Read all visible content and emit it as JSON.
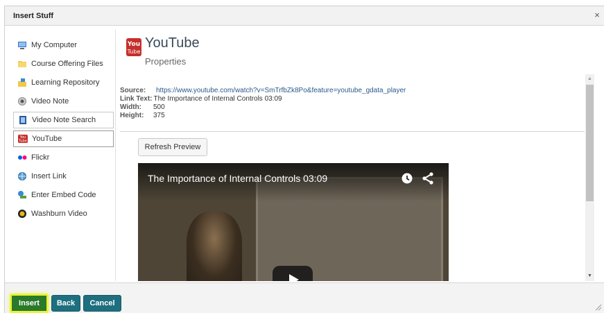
{
  "dialog": {
    "title": "Insert Stuff",
    "close_symbol": "×"
  },
  "sidebar": {
    "items": [
      {
        "label": "My Computer",
        "icon": "computer-icon"
      },
      {
        "label": "Course Offering Files",
        "icon": "folder-icon"
      },
      {
        "label": "Learning Repository",
        "icon": "repository-icon"
      },
      {
        "label": "Video Note",
        "icon": "webcam-icon"
      },
      {
        "label": "Video Note Search",
        "icon": "film-icon"
      },
      {
        "label": "YouTube",
        "icon": "youtube-icon",
        "selected": true
      },
      {
        "label": "Flickr",
        "icon": "flickr-icon"
      },
      {
        "label": "Insert Link",
        "icon": "globe-link-icon"
      },
      {
        "label": "Enter Embed Code",
        "icon": "embed-icon"
      },
      {
        "label": "Washburn Video",
        "icon": "washburn-video-icon"
      }
    ]
  },
  "content": {
    "heading": "YouTube",
    "subheading": "Properties",
    "properties": {
      "source_label": "Source:",
      "source_value": "https://www.youtube.com/watch?v=SmTrfbZk8Po&feature=youtube_gdata_player",
      "link_text_label": "Link Text:",
      "link_text_value": "The Importance of Internal Controls 03:09",
      "width_label": "Width:",
      "width_value": "500",
      "height_label": "Height:",
      "height_value": "375"
    },
    "refresh_label": "Refresh Preview",
    "video": {
      "title": "The Importance of Internal Controls 03:09"
    }
  },
  "footer": {
    "insert_label": "Insert",
    "back_label": "Back",
    "cancel_label": "Cancel"
  },
  "colors": {
    "primary_button": "#1e6f7f",
    "highlight": "#e8f33a",
    "link": "#2a5a8a"
  }
}
